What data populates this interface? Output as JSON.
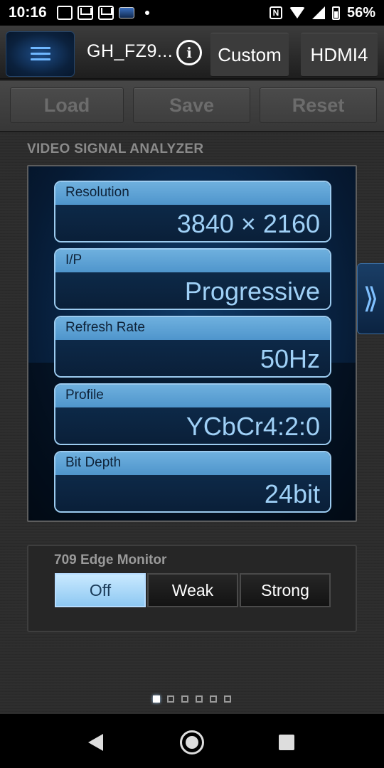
{
  "status_bar": {
    "time": "10:16",
    "left_icons": [
      "message-icon",
      "mail-icon",
      "mail-icon",
      "panasonic-app-icon",
      "notification-dot-icon"
    ],
    "right_icons": [
      "nfc-icon",
      "wifi-icon",
      "signal-icon",
      "battery-icon"
    ],
    "battery_percent": "56%"
  },
  "header": {
    "device_name": "GH_FZ9...",
    "info_icon_glyph": "i",
    "mode_label": "Custom",
    "input_label": "HDMI4"
  },
  "toolbar": {
    "load_label": "Load",
    "save_label": "Save",
    "reset_label": "Reset"
  },
  "analyzer": {
    "title": "VIDEO SIGNAL ANALYZER",
    "fields": [
      {
        "label": "Resolution",
        "value": "3840 × 2160"
      },
      {
        "label": "I/P",
        "value": "Progressive"
      },
      {
        "label": "Refresh Rate",
        "value": "50Hz"
      },
      {
        "label": "Profile",
        "value": "YCbCr4:2:0"
      },
      {
        "label": "Bit Depth",
        "value": "24bit"
      }
    ],
    "next_arrow_glyph": "⟫"
  },
  "edge_monitor": {
    "title": "709 Edge Monitor",
    "options": [
      "Off",
      "Weak",
      "Strong"
    ],
    "selected": "Off"
  },
  "pager": {
    "page_count": 6,
    "current_page": 1
  },
  "colors": {
    "accent": "#6fb7ff",
    "field_label_bg": "#5fa3d6",
    "field_value_text": "#9fd0f6",
    "active_option_bg": "#a9d8f8"
  }
}
